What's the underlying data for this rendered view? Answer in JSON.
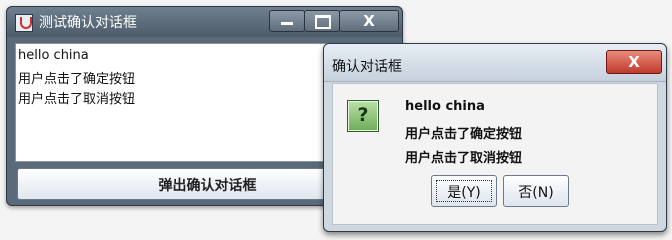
{
  "main_window": {
    "title": "测试确认对话框",
    "text_lines": [
      "hello china",
      "用户点击了确定按钮",
      "用户点击了取消按钮"
    ],
    "popup_button_label": "弹出确认对话框",
    "controls": {
      "minimize_icon": "minimize-icon",
      "maximize_icon": "maximize-icon",
      "close_label": "X"
    }
  },
  "dialog": {
    "title": "确认对话框",
    "close_label": "X",
    "icon": "question-icon",
    "icon_glyph": "?",
    "message_lines": [
      "hello china",
      "用户点击了确定按钮",
      "用户点击了取消按钮"
    ],
    "buttons": {
      "yes_label": "是(Y)",
      "no_label": "否(N)"
    }
  }
}
